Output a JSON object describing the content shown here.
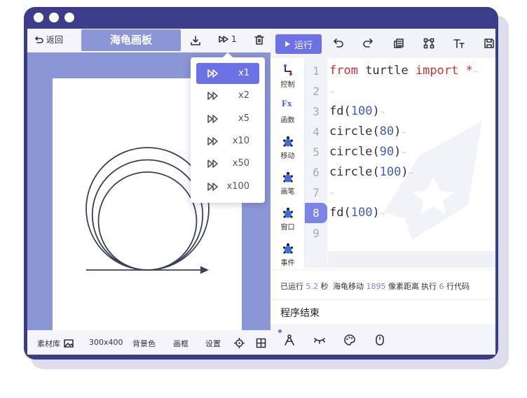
{
  "app": {
    "title": "海龟画板",
    "back_label": "返回",
    "speed_label": "1"
  },
  "speed_menu": {
    "options": [
      "x1",
      "x2",
      "x5",
      "x10",
      "x50",
      "x100"
    ],
    "selected": "x1"
  },
  "canvas_toolbar": {
    "library": "素材库",
    "size": "300x400",
    "background": "背景色",
    "frame": "画框",
    "settings": "设置"
  },
  "editor_toolbar": {
    "run_label": "运行"
  },
  "categories": [
    "控制",
    "函数",
    "移动",
    "画笔",
    "窗口",
    "事件"
  ],
  "categories_fx": "Fx",
  "code": {
    "line_numbers": [
      "1",
      "2",
      "3",
      "4",
      "5",
      "6",
      "7",
      "8",
      "9"
    ],
    "active_line": 8,
    "lines": [
      {
        "kw1": "from",
        "text": " turtle ",
        "kw2": "import",
        "tail": " *"
      },
      {
        "fn": "",
        "num": "",
        "close": ""
      },
      {
        "fn": "fd(",
        "num": "100",
        "close": ")"
      },
      {
        "fn": "circle(",
        "num": "80",
        "close": ")"
      },
      {
        "fn": "circle(",
        "num": "90",
        "close": ")"
      },
      {
        "fn": "circle(",
        "num": "100",
        "close": ")"
      },
      {
        "fn": "",
        "num": "",
        "close": ""
      },
      {
        "fn": "fd(",
        "num": "100",
        "close": ")"
      },
      {
        "fn": "",
        "num": "",
        "close": ""
      }
    ]
  },
  "status": {
    "run_prefix": "已运行",
    "run_time": "5.2",
    "run_unit": "秒",
    "move_prefix": "海龟移动",
    "move_distance": "1895",
    "move_unit": "像素距离",
    "exec_prefix": "执行",
    "exec_lines": "6",
    "exec_unit": "行代码"
  },
  "console": {
    "message": "程序结束"
  },
  "drawing": {
    "forward_1": 100,
    "circles": [
      80,
      90,
      100
    ],
    "forward_2": 100,
    "stroke_color": "#3a4058"
  },
  "colors": {
    "frame": "#3b3d8a",
    "accent": "#6c72e6",
    "canvas_bg": "#8a96d6"
  }
}
